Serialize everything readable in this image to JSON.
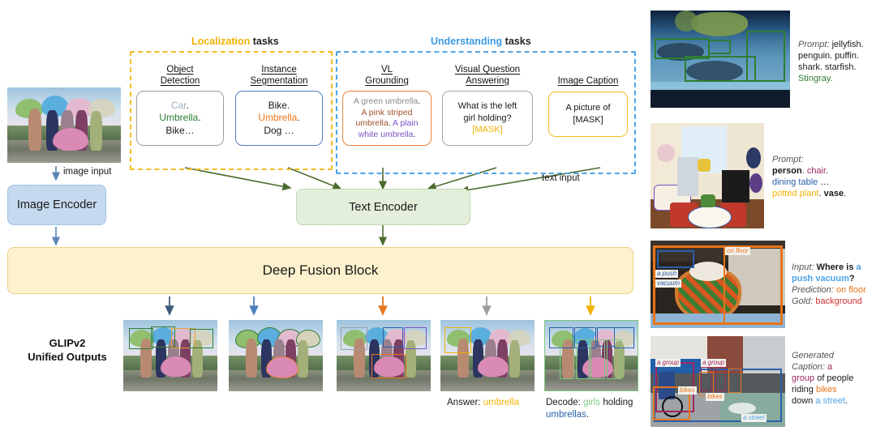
{
  "figure": {
    "model_label_line1": "GLIPv2",
    "model_label_line2": "Unified Outputs",
    "image_input_label": "image input",
    "text_input_label": "text input"
  },
  "groups": {
    "localization": {
      "accent_word": "Localization",
      "rest": " tasks",
      "color": "#f2b203"
    },
    "understanding": {
      "accent_word": "Understanding",
      "rest": " tasks",
      "color": "#3d9ae2"
    }
  },
  "tasks": [
    {
      "name": "object-detection",
      "head_line1": "Object",
      "head_line2": "Detection",
      "border_color": "#9aa0a6",
      "lines": [
        [
          {
            "t": "Car",
            "c": "c-gray"
          },
          {
            "t": ".",
            "c": "c-dark"
          }
        ],
        [
          {
            "t": "Umbrella",
            "c": "c-green"
          },
          {
            "t": ".",
            "c": "c-dark"
          }
        ],
        [
          {
            "t": "Bike…",
            "c": "c-dark"
          }
        ]
      ]
    },
    {
      "name": "instance-segmentation",
      "head_line1": "Instance",
      "head_line2": "Segmentation",
      "border_color": "#4f81bd",
      "lines": [
        [
          {
            "t": "Bike",
            "c": "c-dark"
          },
          {
            "t": ".",
            "c": "c-dark"
          }
        ],
        [
          {
            "t": "Umbrella",
            "c": "c-orange"
          },
          {
            "t": ".",
            "c": "c-dark"
          }
        ],
        [
          {
            "t": "Dog …",
            "c": "c-dark"
          }
        ]
      ]
    },
    {
      "name": "vl-grounding",
      "head_line1": "VL",
      "head_line2": "Grounding",
      "border_color": "#e8833a",
      "lines": [
        [
          {
            "t": "A green umbrella",
            "c": "c-lgray"
          },
          {
            "t": ".",
            "c": "c-dark"
          }
        ],
        [
          {
            "t": "A pink striped",
            "c": "c-brown"
          }
        ],
        [
          {
            "t": "umbrella",
            "c": "c-brown"
          },
          {
            "t": ". ",
            "c": "c-dark"
          },
          {
            "t": "A plain",
            "c": "c-purple"
          }
        ],
        [
          {
            "t": "white umbrella",
            "c": "c-purple"
          },
          {
            "t": ".",
            "c": "c-dark"
          }
        ]
      ]
    },
    {
      "name": "visual-question-answering",
      "head_line1": "Visual Question",
      "head_line2": "Answering",
      "border_color": "#a6a6a6",
      "lines": [
        [
          {
            "t": "What is the left",
            "c": "c-dark"
          }
        ],
        [
          {
            "t": "girl holding?",
            "c": "c-dark"
          }
        ],
        [
          {
            "t": "[MASK]",
            "c": "c-yellow"
          }
        ]
      ]
    },
    {
      "name": "image-caption",
      "head_line1": "Image Caption",
      "head_line2": "",
      "border_color": "#f5bc22",
      "lines": [
        [
          {
            "t": "A picture of",
            "c": "c-dark"
          }
        ],
        [
          {
            "t": "[MASK]",
            "c": "c-dark"
          }
        ]
      ]
    }
  ],
  "blocks": {
    "image_encoder": {
      "label": "Image Encoder",
      "fill": "#c5d9ef"
    },
    "text_encoder": {
      "label": "Text Encoder",
      "fill": "#e3efda"
    },
    "deep_fusion": {
      "label": "Deep Fusion Block",
      "fill": "#fdf2cd"
    }
  },
  "output_arrow_colors": [
    "#3f5c7a",
    "#4f81bd",
    "#e8751a",
    "#9e9e9e",
    "#f2b203"
  ],
  "output_captions": {
    "answer_prefix": "Answer: ",
    "answer_value": "umbrella",
    "decode_prefix": "Decode",
    "decode_colon": ": ",
    "decode_girls": "girls",
    "decode_mid": " holding ",
    "decode_umbrellas": "umbrellas",
    "decode_period": "."
  },
  "right_panels": [
    {
      "name": "odinw-stingray",
      "caption_lines": [
        [
          {
            "t": "Prompt:",
            "s": "i"
          },
          {
            "t": " jellyfish.",
            "c": "c-dark"
          }
        ],
        [
          {
            "t": "penguin. puffin.",
            "c": "c-dark"
          }
        ],
        [
          {
            "t": "shark. starfish.",
            "c": "c-dark"
          }
        ],
        [
          {
            "t": "Stingray.",
            "c": "c-green"
          }
        ]
      ]
    },
    {
      "name": "detection-living-room",
      "caption_lines": [
        [
          {
            "t": "Prompt:",
            "s": "i"
          }
        ],
        [
          {
            "t": "person",
            "c": "c-dark",
            "s": "b"
          },
          {
            "t": ". ",
            "c": "c-dark"
          },
          {
            "t": "chair",
            "c": "c-magenta"
          },
          {
            "t": ".",
            "c": "c-dark"
          }
        ],
        [
          {
            "t": "dining table",
            "c": "c-blue"
          },
          {
            "t": " …",
            "c": "c-dark"
          }
        ],
        [
          {
            "t": "potted plant",
            "c": "c-yellow"
          },
          {
            "t": ". ",
            "c": "c-dark"
          },
          {
            "t": "vase",
            "c": "c-dark",
            "s": "b"
          },
          {
            "t": ".",
            "c": "c-dark"
          }
        ]
      ]
    },
    {
      "name": "vqa-push-vacuum",
      "caption_lines": [
        [
          {
            "t": "Input:",
            "s": "i"
          },
          {
            "t": " Where is ",
            "c": "c-dark",
            "s": "b"
          },
          {
            "t": "a",
            "c": "c-skyblue",
            "s": "b"
          }
        ],
        [
          {
            "t": "push vacuum",
            "c": "c-skyblue",
            "s": "b"
          },
          {
            "t": "?",
            "c": "c-dark",
            "s": "b"
          }
        ],
        [
          {
            "t": "Prediction:",
            "s": "i"
          },
          {
            "t": " on floor",
            "c": "c-orange"
          }
        ],
        [
          {
            "t": "Gold:",
            "s": "i"
          },
          {
            "t": " background",
            "c": "c-red"
          }
        ]
      ],
      "image_tags": [
        {
          "t": "on floor",
          "c": "#e8751a"
        },
        {
          "t": "a push",
          "c": "#2b5faa"
        },
        {
          "t": "vacuum",
          "c": "#2b5faa"
        }
      ]
    },
    {
      "name": "caption-bikes-street",
      "caption_lines": [
        [
          {
            "t": "Generated",
            "s": "i"
          }
        ],
        [
          {
            "t": "Caption:",
            "s": "i"
          },
          {
            "t": " a",
            "c": "c-magenta"
          }
        ],
        [
          {
            "t": "group",
            "c": "c-magenta"
          },
          {
            "t": " of people",
            "c": "c-dark"
          }
        ],
        [
          {
            "t": "riding ",
            "c": "c-dark"
          },
          {
            "t": "bikes",
            "c": "c-orange"
          }
        ],
        [
          {
            "t": "down ",
            "c": "c-dark"
          },
          {
            "t": "a street",
            "c": "c-skyblue"
          },
          {
            "t": ".",
            "c": "c-dark"
          }
        ]
      ],
      "image_tags": [
        {
          "t": "a group",
          "c": "#a0255f"
        },
        {
          "t": "a group",
          "c": "#a0255f"
        },
        {
          "t": "bikes",
          "c": "#e8751a"
        },
        {
          "t": "bikes",
          "c": "#e8751a"
        },
        {
          "t": "a street",
          "c": "#4da3e8"
        }
      ]
    }
  ],
  "chart_data": {
    "type": "diagram",
    "title": "GLIPv2 unified VL architecture",
    "nodes": [
      "Image Encoder",
      "Text Encoder",
      "Deep Fusion Block"
    ],
    "task_heads": [
      "Object Detection",
      "Instance Segmentation",
      "VL Grounding",
      "Visual Question Answering",
      "Image Caption"
    ],
    "edges": [
      {
        "from": "input image",
        "to": "Image Encoder",
        "label": "image input"
      },
      {
        "from": "task prompts",
        "to": "Text Encoder",
        "label": "text input"
      },
      {
        "from": "Image Encoder",
        "to": "Deep Fusion Block"
      },
      {
        "from": "Text Encoder",
        "to": "Deep Fusion Block"
      },
      {
        "from": "Deep Fusion Block",
        "to": "outputs"
      }
    ]
  }
}
